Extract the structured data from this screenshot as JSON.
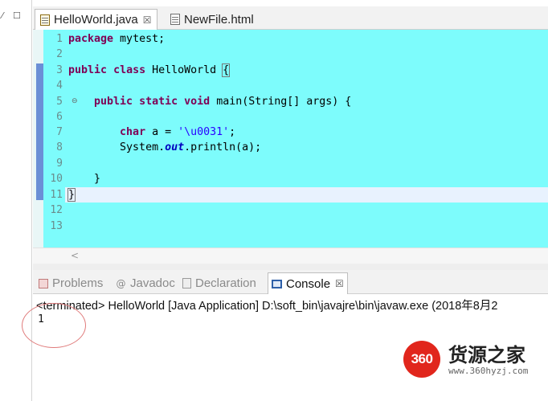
{
  "left_strip": {
    "restore_glyph": "⁄",
    "maximize_glyph": "☐"
  },
  "editor_tabs": [
    {
      "label": "HelloWorld.java",
      "close": "☒",
      "active": true,
      "icon": "java-file-icon"
    },
    {
      "label": "NewFile.html",
      "active": false,
      "icon": "html-file-icon"
    }
  ],
  "editor": {
    "background": "#7dfcfc",
    "line_numbers": [
      "1",
      "2",
      "3",
      "4",
      "5",
      "6",
      "7",
      "8",
      "9",
      "10",
      "11",
      "12",
      "13"
    ],
    "fold_marker": "⊖",
    "lines": {
      "l1": {
        "kw": "package",
        "rest": " mytest;"
      },
      "l3": {
        "kw1": "public",
        "kw2": "class",
        "name": " HelloWorld ",
        "brace": "{"
      },
      "l5": {
        "indent": "    ",
        "kw1": "public",
        "kw2": "static",
        "kw3": "void",
        "rest": " main(String[] args) {"
      },
      "l7": {
        "indent": "        ",
        "kw": "char",
        "mid": " a = ",
        "str": "'\\u0031'",
        "end": ";"
      },
      "l8": {
        "pre": "        System.",
        "field": "out",
        "post": ".println(a);"
      },
      "l10": {
        "text": "    }"
      },
      "l11": {
        "text": "}"
      }
    }
  },
  "hscroll": {
    "left_arrow": "<"
  },
  "view_tabs": [
    {
      "label": "Problems",
      "icon": "problems-icon",
      "active": false
    },
    {
      "label": "Javadoc",
      "icon": "javadoc-icon",
      "glyph": "@",
      "active": false
    },
    {
      "label": "Declaration",
      "icon": "declaration-icon",
      "active": false
    },
    {
      "label": "Console",
      "icon": "console-icon",
      "active": true,
      "close": "☒"
    }
  ],
  "console": {
    "header": "<terminated> HelloWorld [Java Application] D:\\soft_bin\\javajre\\bin\\javaw.exe (2018年8月2",
    "output": "1"
  },
  "watermark": {
    "logo": "360",
    "name": "货源之家",
    "url": "www.360hyzj.com"
  }
}
